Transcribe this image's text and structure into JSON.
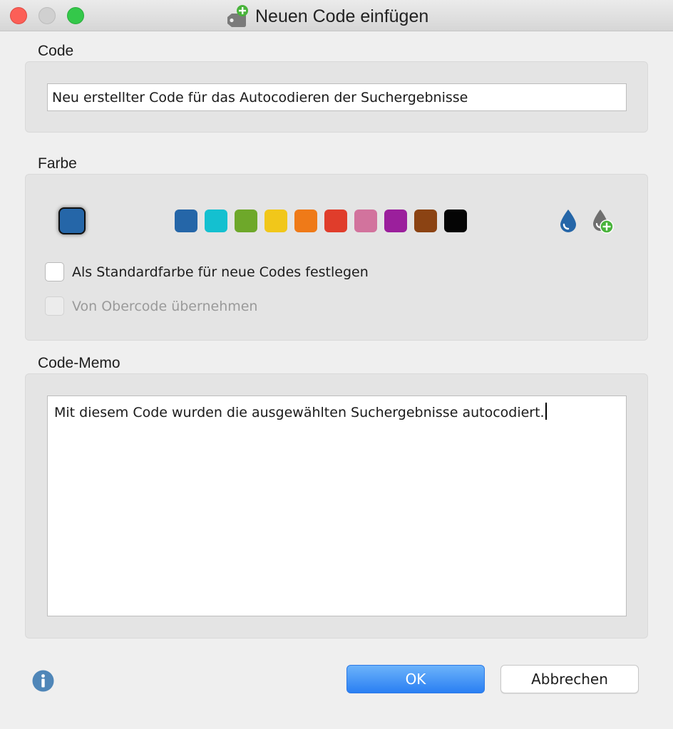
{
  "window": {
    "title": "Neuen Code einfügen"
  },
  "code_section": {
    "label": "Code",
    "value": "Neu erstellter Code für das Autocodieren der Suchergebnisse"
  },
  "color_section": {
    "label": "Farbe",
    "current_color": "#2566a8",
    "palette": [
      "#2566a8",
      "#14c0d0",
      "#6ea82a",
      "#f1c71a",
      "#ef7a18",
      "#e03d2b",
      "#d2739d",
      "#9b1f9c",
      "#8b4313",
      "#050505"
    ],
    "icons": [
      "color-drop-icon",
      "add-color-drop-icon"
    ],
    "checkbox_default": {
      "label": "Als Standardfarbe für neue Codes festlegen",
      "checked": false,
      "enabled": true
    },
    "checkbox_inherit": {
      "label": "Von Obercode übernehmen",
      "checked": false,
      "enabled": false
    }
  },
  "memo_section": {
    "label": "Code-Memo",
    "value": "Mit diesem Code wurden die ausgewählten Suchergebnisse autocodiert."
  },
  "buttons": {
    "ok": "OK",
    "cancel": "Abbrechen"
  },
  "colors": {
    "accent": "#2a7ff3",
    "info": "#4f86b8",
    "add_green": "#49b33b"
  }
}
